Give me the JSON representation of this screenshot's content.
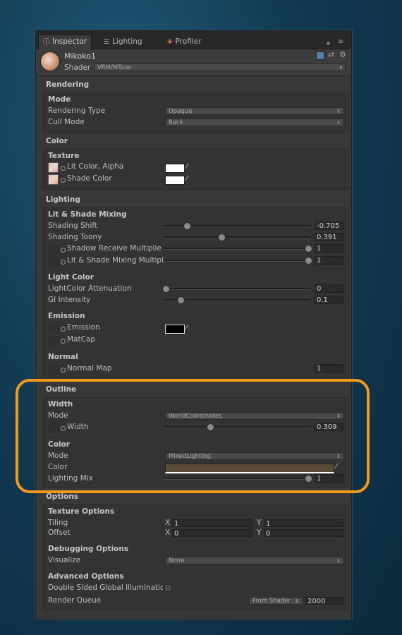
{
  "tabs": [
    {
      "label": "Inspector",
      "icon": "info-icon"
    },
    {
      "label": "Lighting",
      "icon": "lighting-icon"
    },
    {
      "label": "Profiler",
      "icon": "profiler-icon"
    }
  ],
  "object": {
    "name": "Mikoko1",
    "shader_label": "Shader",
    "shader_value": "VRM/MToon"
  },
  "rendering": {
    "title": "Rendering",
    "mode_title": "Mode",
    "rendering_type_label": "Rendering Type",
    "rendering_type_value": "Opaque",
    "cull_mode_label": "Cull Mode",
    "cull_mode_value": "Back"
  },
  "color": {
    "title": "Color",
    "texture_title": "Texture",
    "lit_label": "Lit Color, Alpha",
    "shade_label": "Shade Color"
  },
  "lighting": {
    "title": "Lighting",
    "mixing_title": "Lit & Shade Mixing",
    "shading_shift_label": "Shading Shift",
    "shading_shift_value": "-0.705",
    "shading_toony_label": "Shading Toony",
    "shading_toony_value": "0.391",
    "shadow_receive_label": "Shadow Receive Multiplier",
    "shadow_receive_value": "1",
    "mixing_mult_label": "Lit & Shade Mixing Multiplier",
    "mixing_mult_value": "1",
    "light_color_title": "Light Color",
    "attenuation_label": "LightColor Attenuation",
    "attenuation_value": "0",
    "gi_label": "GI Intensity",
    "gi_value": "0.1",
    "emission_title": "Emission",
    "emission_label": "Emission",
    "matcap_label": "MatCap",
    "normal_title": "Normal",
    "normal_map_label": "Normal Map",
    "normal_map_value": "1"
  },
  "outline": {
    "title": "Outline",
    "width_title": "Width",
    "width_mode_label": "Mode",
    "width_mode_value": "WorldCoordinates",
    "width_label": "Width",
    "width_value": "0.309",
    "color_title": "Color",
    "color_mode_label": "Mode",
    "color_mode_value": "MixedLighting",
    "color_label": "Color",
    "lighting_mix_label": "Lighting Mix",
    "lighting_mix_value": "1",
    "outline_color": "#5a4a38"
  },
  "options": {
    "title": "Options",
    "texture_options_title": "Texture Options",
    "tiling_label": "Tiling",
    "tiling_x": "1",
    "tiling_y": "1",
    "offset_label": "Offset",
    "offset_x": "0",
    "offset_y": "0",
    "x_axis": "X",
    "y_axis": "Y",
    "debugging_title": "Debugging Options",
    "visualize_label": "Visualize",
    "visualize_value": "None",
    "advanced_title": "Advanced Options",
    "double_sided_label": "Double Sided Global Illumination",
    "render_queue_label": "Render Queue",
    "render_queue_mode": "From Shader",
    "render_queue_value": "2000"
  },
  "colors": {
    "highlight": "#f39a1a",
    "panel": "#383838"
  }
}
